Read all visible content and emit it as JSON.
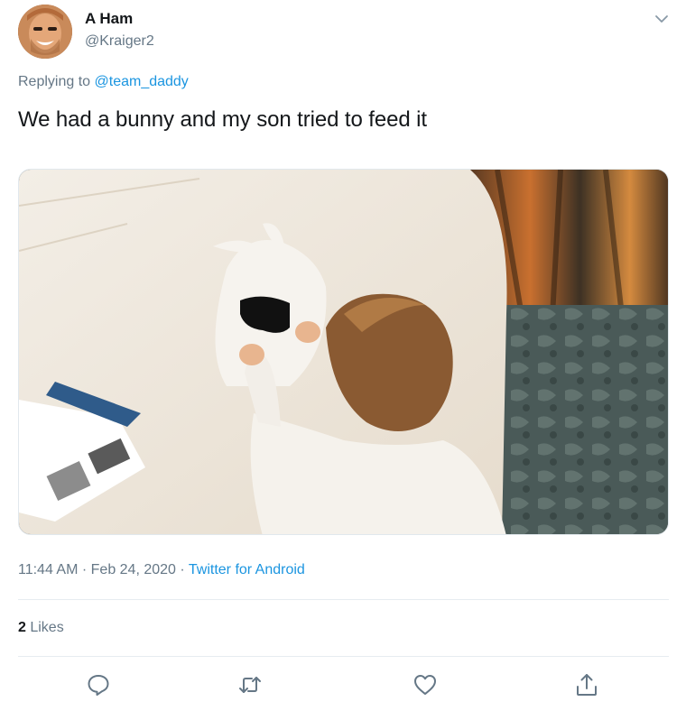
{
  "author": {
    "display_name": "A Ham",
    "handle": "@Kraiger2",
    "avatar_icon": "avatar-photo"
  },
  "reply": {
    "prefix": "Replying to ",
    "mention": "@team_daddy"
  },
  "tweet": {
    "text": "We had a bunny and my son tried to feed it",
    "photo_description_icon": "tweet-photo"
  },
  "meta": {
    "time": "11:44 AM",
    "separator1": " · ",
    "date": "Feb 24, 2020",
    "separator2": " · ",
    "source": "Twitter for Android"
  },
  "stats": {
    "likes_count": "2",
    "likes_label": " Likes"
  },
  "actions": {
    "reply_icon": "reply-icon",
    "retweet_icon": "retweet-icon",
    "like_icon": "heart-icon",
    "share_icon": "share-icon"
  },
  "colors": {
    "link": "#1b95e0",
    "secondary_text": "#657786",
    "primary_text": "#14171a",
    "divider": "#e6ecf0"
  }
}
